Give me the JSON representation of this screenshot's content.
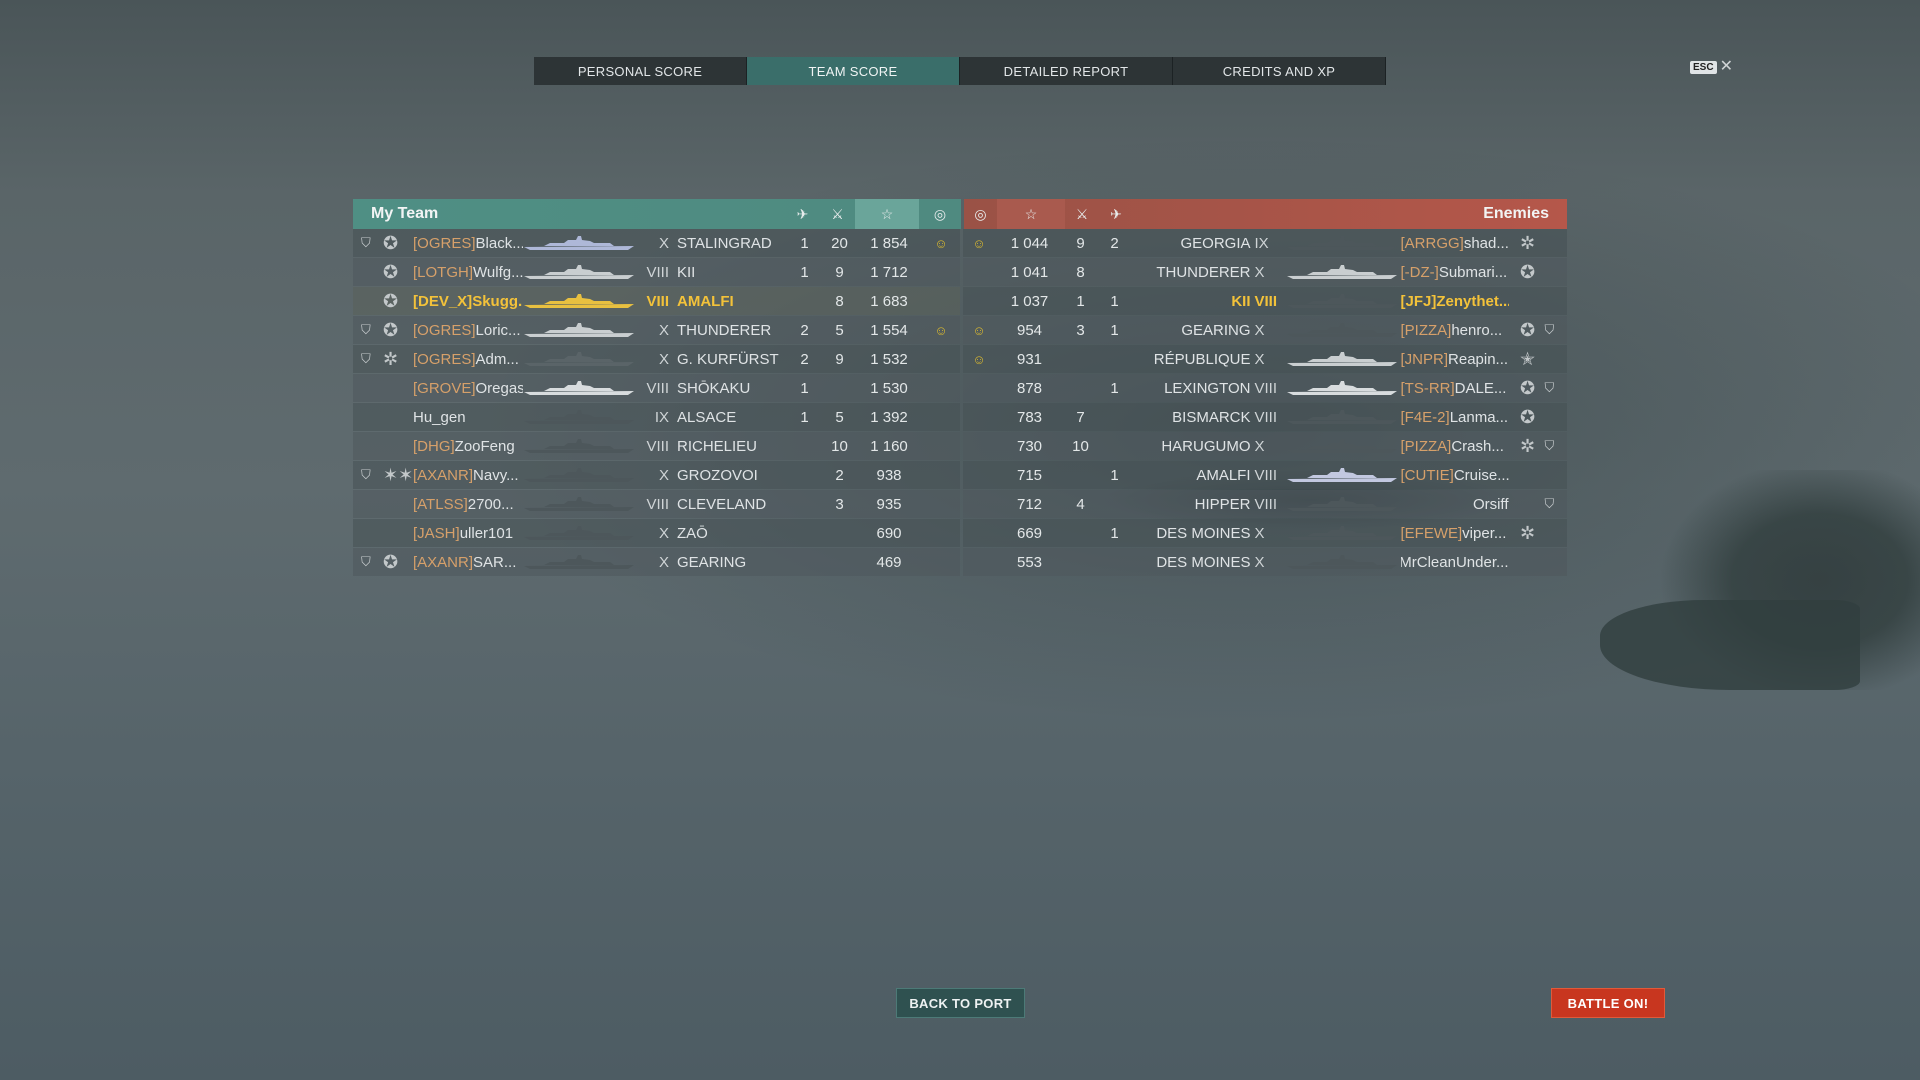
{
  "tabs": [
    "PERSONAL SCORE",
    "TEAM SCORE",
    "DETAILED REPORT",
    "CREDITS AND XP"
  ],
  "active_tab": 1,
  "esc_label": "ESC",
  "close_symbol": "✕",
  "my_team_title": "My Team",
  "enemies_title": "Enemies",
  "header_icons": {
    "planes": "plane-icon",
    "kills": "crossed-swords-icon",
    "score": "star-icon",
    "base": "capture-icon"
  },
  "my_team": [
    {
      "badge": "⛉",
      "rank": "✪",
      "clan": "[OGRES]",
      "name": "Black...",
      "tier": "X",
      "ship": "STALINGRAD",
      "c1": "1",
      "c2": "20",
      "score": "1 854",
      "skull": "☺",
      "ship_color": "#aeb8d8",
      "highlight": false
    },
    {
      "badge": "",
      "rank": "✪",
      "clan": "[LOTGH]",
      "name": "Wulfg...",
      "tier": "VIII",
      "ship": "KII",
      "c1": "1",
      "c2": "9",
      "score": "1 712",
      "skull": "",
      "ship_color": "#c9ced0",
      "highlight": false
    },
    {
      "badge": "",
      "rank": "✪",
      "clan": "[DEV_X]",
      "name": "Skugg...",
      "tier": "VIII",
      "ship": "AMALFI",
      "c1": "",
      "c2": "8",
      "score": "1 683",
      "skull": "",
      "ship_color": "#e8c040",
      "highlight": true
    },
    {
      "badge": "⛉",
      "rank": "✪",
      "clan": "[OGRES]",
      "name": "Loric...",
      "tier": "X",
      "ship": "THUNDERER",
      "c1": "2",
      "c2": "5",
      "score": "1 554",
      "skull": "☺",
      "ship_color": "#c9ced0",
      "highlight": false
    },
    {
      "badge": "⛉",
      "rank": "✲",
      "clan": "[OGRES]",
      "name": "Adm...",
      "tier": "X",
      "ship": "G. KURFÜRST",
      "c1": "2",
      "c2": "9",
      "score": "1 532",
      "skull": "",
      "ship_color": "#5a6468",
      "highlight": false
    },
    {
      "badge": "",
      "rank": "",
      "clan": "[GROVE]",
      "name": "Oregas",
      "tier": "VIII",
      "ship": "SHŌKAKU",
      "c1": "1",
      "c2": "",
      "score": "1 530",
      "skull": "",
      "ship_color": "#d8dcde",
      "highlight": false
    },
    {
      "badge": "",
      "rank": "",
      "clan": "",
      "name": "Hu_gen",
      "tier": "IX",
      "ship": "ALSACE",
      "c1": "1",
      "c2": "5",
      "score": "1 392",
      "skull": "",
      "ship_color": "#4d575b",
      "highlight": false
    },
    {
      "badge": "",
      "rank": "",
      "clan": "[DHG]",
      "name": "ZooFeng",
      "tier": "VIII",
      "ship": "RICHELIEU",
      "c1": "",
      "c2": "10",
      "score": "1 160",
      "skull": "",
      "ship_color": "#4d575b",
      "highlight": false
    },
    {
      "badge": "⛉",
      "rank": "✶✶",
      "clan": "[AXANR]",
      "name": "Navy...",
      "tier": "X",
      "ship": "GROZOVOI",
      "c1": "",
      "c2": "2",
      "score": "938",
      "skull": "",
      "ship_color": "#4d575b",
      "highlight": false
    },
    {
      "badge": "",
      "rank": "",
      "clan": "[ATLSS]",
      "name": "2700...",
      "tier": "VIII",
      "ship": "CLEVELAND",
      "c1": "",
      "c2": "3",
      "score": "935",
      "skull": "",
      "ship_color": "#4d575b",
      "highlight": false
    },
    {
      "badge": "",
      "rank": "",
      "clan": "[JASH]",
      "name": "uller101",
      "tier": "X",
      "ship": "ZAŌ",
      "c1": "",
      "c2": "",
      "score": "690",
      "skull": "",
      "ship_color": "#4d575b",
      "highlight": false
    },
    {
      "badge": "⛉",
      "rank": "✪",
      "clan": "[AXANR]",
      "name": "SAR...",
      "tier": "X",
      "ship": "GEARING",
      "c1": "",
      "c2": "",
      "score": "469",
      "skull": "",
      "ship_color": "#4d575b",
      "highlight": false
    }
  ],
  "enemies": [
    {
      "skull": "☺",
      "score": "1 044",
      "c2": "9",
      "c1": "2",
      "ship": "GEORGIA",
      "tier": "IX",
      "clan": "[ARRGG]",
      "name": "shad...",
      "rank": "✲",
      "badge": "",
      "ship_color": "#4d575b"
    },
    {
      "skull": "",
      "score": "1 041",
      "c2": "8",
      "c1": "",
      "ship": "THUNDERER",
      "tier": "X",
      "clan": "[-DZ-]",
      "name": "Submari...",
      "rank": "✪",
      "badge": "",
      "ship_color": "#c9ced0"
    },
    {
      "skull": "",
      "score": "1 037",
      "c2": "1",
      "c1": "1",
      "ship": "KII",
      "tier": "VIII",
      "clan": "[JFJ]",
      "name": "Zenythet...",
      "rank": "",
      "badge": "",
      "ship_color": "#4d575b"
    },
    {
      "skull": "☺",
      "score": "954",
      "c2": "3",
      "c1": "1",
      "ship": "GEARING",
      "tier": "X",
      "clan": "[PIZZA]",
      "name": "henro...",
      "rank": "✪",
      "badge": "⛉",
      "ship_color": "#4d575b"
    },
    {
      "skull": "☺",
      "score": "931",
      "c2": "",
      "c1": "",
      "ship": "RÉPUBLIQUE",
      "tier": "X",
      "clan": "[JNPR]",
      "name": "Reapin...",
      "rank": "✭",
      "badge": "",
      "ship_color": "#c9ced0"
    },
    {
      "skull": "",
      "score": "878",
      "c2": "",
      "c1": "1",
      "ship": "LEXINGTON",
      "tier": "VIII",
      "clan": "[TS-RR]",
      "name": "DALE...",
      "rank": "✪",
      "badge": "⛉",
      "ship_color": "#d8dcde"
    },
    {
      "skull": "",
      "score": "783",
      "c2": "7",
      "c1": "",
      "ship": "BISMARCK",
      "tier": "VIII",
      "clan": "[F4E-2]",
      "name": "Lanma...",
      "rank": "✪",
      "badge": "",
      "ship_color": "#4d575b"
    },
    {
      "skull": "",
      "score": "730",
      "c2": "10",
      "c1": "",
      "ship": "HARUGUMO",
      "tier": "X",
      "clan": "[PIZZA]",
      "name": "Crash...",
      "rank": "✲",
      "badge": "⛉",
      "ship_color": "#4d575b"
    },
    {
      "skull": "",
      "score": "715",
      "c2": "",
      "c1": "1",
      "ship": "AMALFI",
      "tier": "VIII",
      "clan": "[CUTIE]",
      "name": "Cruise...",
      "rank": "",
      "badge": "",
      "ship_color": "#c2c8e0"
    },
    {
      "skull": "",
      "score": "712",
      "c2": "4",
      "c1": "",
      "ship": "HIPPER",
      "tier": "VIII",
      "clan": "",
      "name": "Orsiff",
      "rank": "",
      "badge": "⛉",
      "ship_color": "#4d575b"
    },
    {
      "skull": "",
      "score": "669",
      "c2": "",
      "c1": "1",
      "ship": "DES MOINES",
      "tier": "X",
      "clan": "[EFEWE]",
      "name": "viper...",
      "rank": "✲",
      "badge": "",
      "ship_color": "#4d575b"
    },
    {
      "skull": "",
      "score": "553",
      "c2": "",
      "c1": "",
      "ship": "DES MOINES",
      "tier": "X",
      "clan": "",
      "name": "MrCleanUnder...",
      "rank": "",
      "badge": "",
      "ship_color": "#4d575b"
    }
  ],
  "buttons": {
    "back_to_port": "BACK TO PORT",
    "battle_on": "BATTLE ON!"
  }
}
